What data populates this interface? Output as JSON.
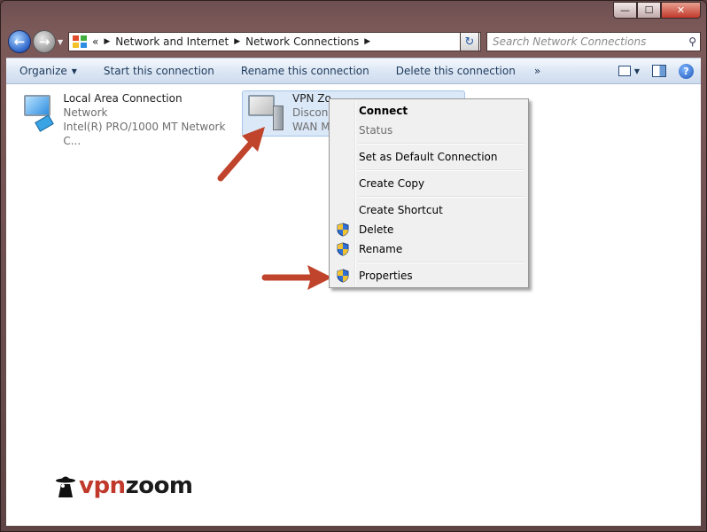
{
  "window": {
    "minimize_glyph": "—",
    "maximize_glyph": "☐",
    "close_glyph": "✕"
  },
  "nav": {
    "back_glyph": "←",
    "forward_glyph": "→"
  },
  "address": {
    "overflow": "«",
    "crumbs": [
      "Network and Internet",
      "Network Connections"
    ],
    "refresh_glyph": "↻"
  },
  "search": {
    "placeholder": "Search Network Connections",
    "icon": "search-icon"
  },
  "toolbar": {
    "organize": "Organize",
    "start": "Start this connection",
    "rename": "Rename this connection",
    "delete": "Delete this connection",
    "more": "»",
    "help": "?"
  },
  "connections": [
    {
      "name": "Local Area Connection",
      "status": "Network",
      "device": "Intel(R) PRO/1000 MT Network C..."
    },
    {
      "name": "VPN Zo",
      "status": "Disconn",
      "device": "WAN M"
    }
  ],
  "context_menu": {
    "items": [
      {
        "label": "Connect",
        "bold": true
      },
      {
        "label": "Status",
        "disabled": true
      },
      {
        "label": "Set as Default Connection"
      },
      {
        "label": "Create Copy"
      },
      {
        "label": "Create Shortcut"
      },
      {
        "label": "Delete",
        "shield": true
      },
      {
        "label": "Rename",
        "shield": true
      },
      {
        "label": "Properties",
        "shield": true
      }
    ]
  },
  "watermark": {
    "vpn": "vpn",
    "zoom": "zoom"
  },
  "colors": {
    "arrow": "#c0442b",
    "selection": "#dbe8f8",
    "toolbar_text": "#1e395b"
  }
}
